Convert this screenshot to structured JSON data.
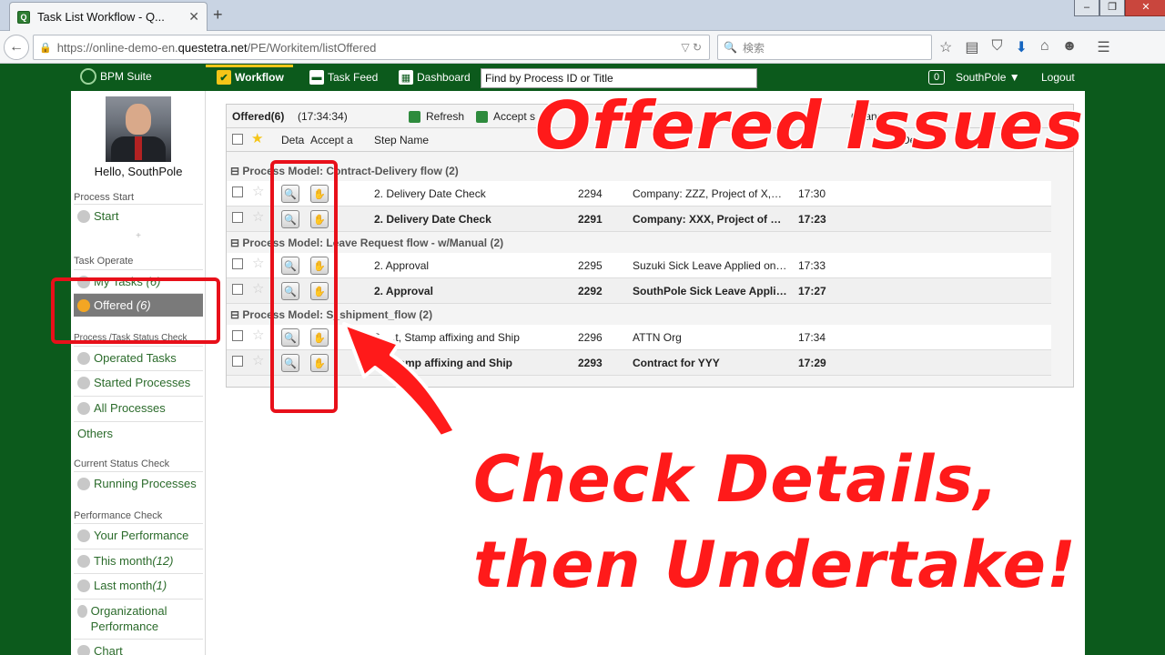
{
  "browser": {
    "tab_title": "Task List Workflow - Q...",
    "url_prefix": "https://online-demo-en.",
    "url_host": "questetra.net",
    "url_path": "/PE/Workitem/listOffered",
    "search_placeholder": "検索"
  },
  "app": {
    "logo": "BPM Suite",
    "menu": [
      "Workflow",
      "Task Feed",
      "Dashboard"
    ],
    "find_placeholder": "Find by Process ID or Title",
    "badge": "0",
    "user": "SouthPole ▼",
    "logout": "Logout"
  },
  "sidebar": {
    "hello": "Hello, SouthPole",
    "process_start": "Process Start",
    "start": "Start",
    "task_operate": "Task Operate",
    "my_tasks": "My Tasks",
    "my_tasks_count": "(6)",
    "offered": "Offered",
    "offered_count": "(6)",
    "status_check": "Process /Task Status Check",
    "operated": "Operated Tasks",
    "started": "Started Processes",
    "all": "All Processes",
    "others": "Others",
    "current_status": "Current Status Check",
    "running": "Running Processes",
    "performance": "Performance Check",
    "your_perf": "Your Performance",
    "this_month": "This month",
    "this_month_count": "(12)",
    "last_month": "Last month",
    "last_month_count": "(1)",
    "org_perf": "Organizational Performance",
    "chart": "Chart"
  },
  "panel": {
    "title": "Offered(6)",
    "time": "(17:34:34)",
    "refresh": "Refresh",
    "accept": "Accept s",
    "change": "Change",
    "col_detail": "Deta",
    "col_accept": "Accept a",
    "col_step": "Step Name",
    "col_sort": "▼",
    "col_due": "De",
    "groups": [
      {
        "name": "Process Model: Contract-Delivery flow (2)",
        "rows": [
          {
            "step": "2. Delivery Date Check",
            "id": "2294",
            "title": "Company: ZZZ, Project of X,…",
            "time": "17:30"
          },
          {
            "step": "2. Delivery Date Check",
            "id": "2291",
            "title": "Company: XXX, Project of …",
            "time": "17:23"
          }
        ]
      },
      {
        "name": "Process Model: Leave Request flow - w/Manual (2)",
        "rows": [
          {
            "step": "2. Approval",
            "id": "2295",
            "title": "Suzuki Sick Leave Applied on…",
            "time": "17:33"
          },
          {
            "step": "2. Approval",
            "id": "2292",
            "title": "SouthPole Sick Leave Appli…",
            "time": "17:27"
          }
        ]
      },
      {
        "name": "Process Model: S_shipment_flow (2)",
        "rows": [
          {
            "step": "2. ...t, Stamp affixing and Ship",
            "id": "2296",
            "title": "ATTN Org",
            "time": "17:34"
          },
          {
            "step": "2. ...tamp affixing and Ship",
            "id": "2293",
            "title": "Contract for YYY",
            "time": "17:29"
          }
        ]
      }
    ]
  },
  "overlay": {
    "headline": "Offered Issues",
    "line1": "Check Details,",
    "line2": "then Undertake!",
    "accent": "#ff1a1a"
  }
}
